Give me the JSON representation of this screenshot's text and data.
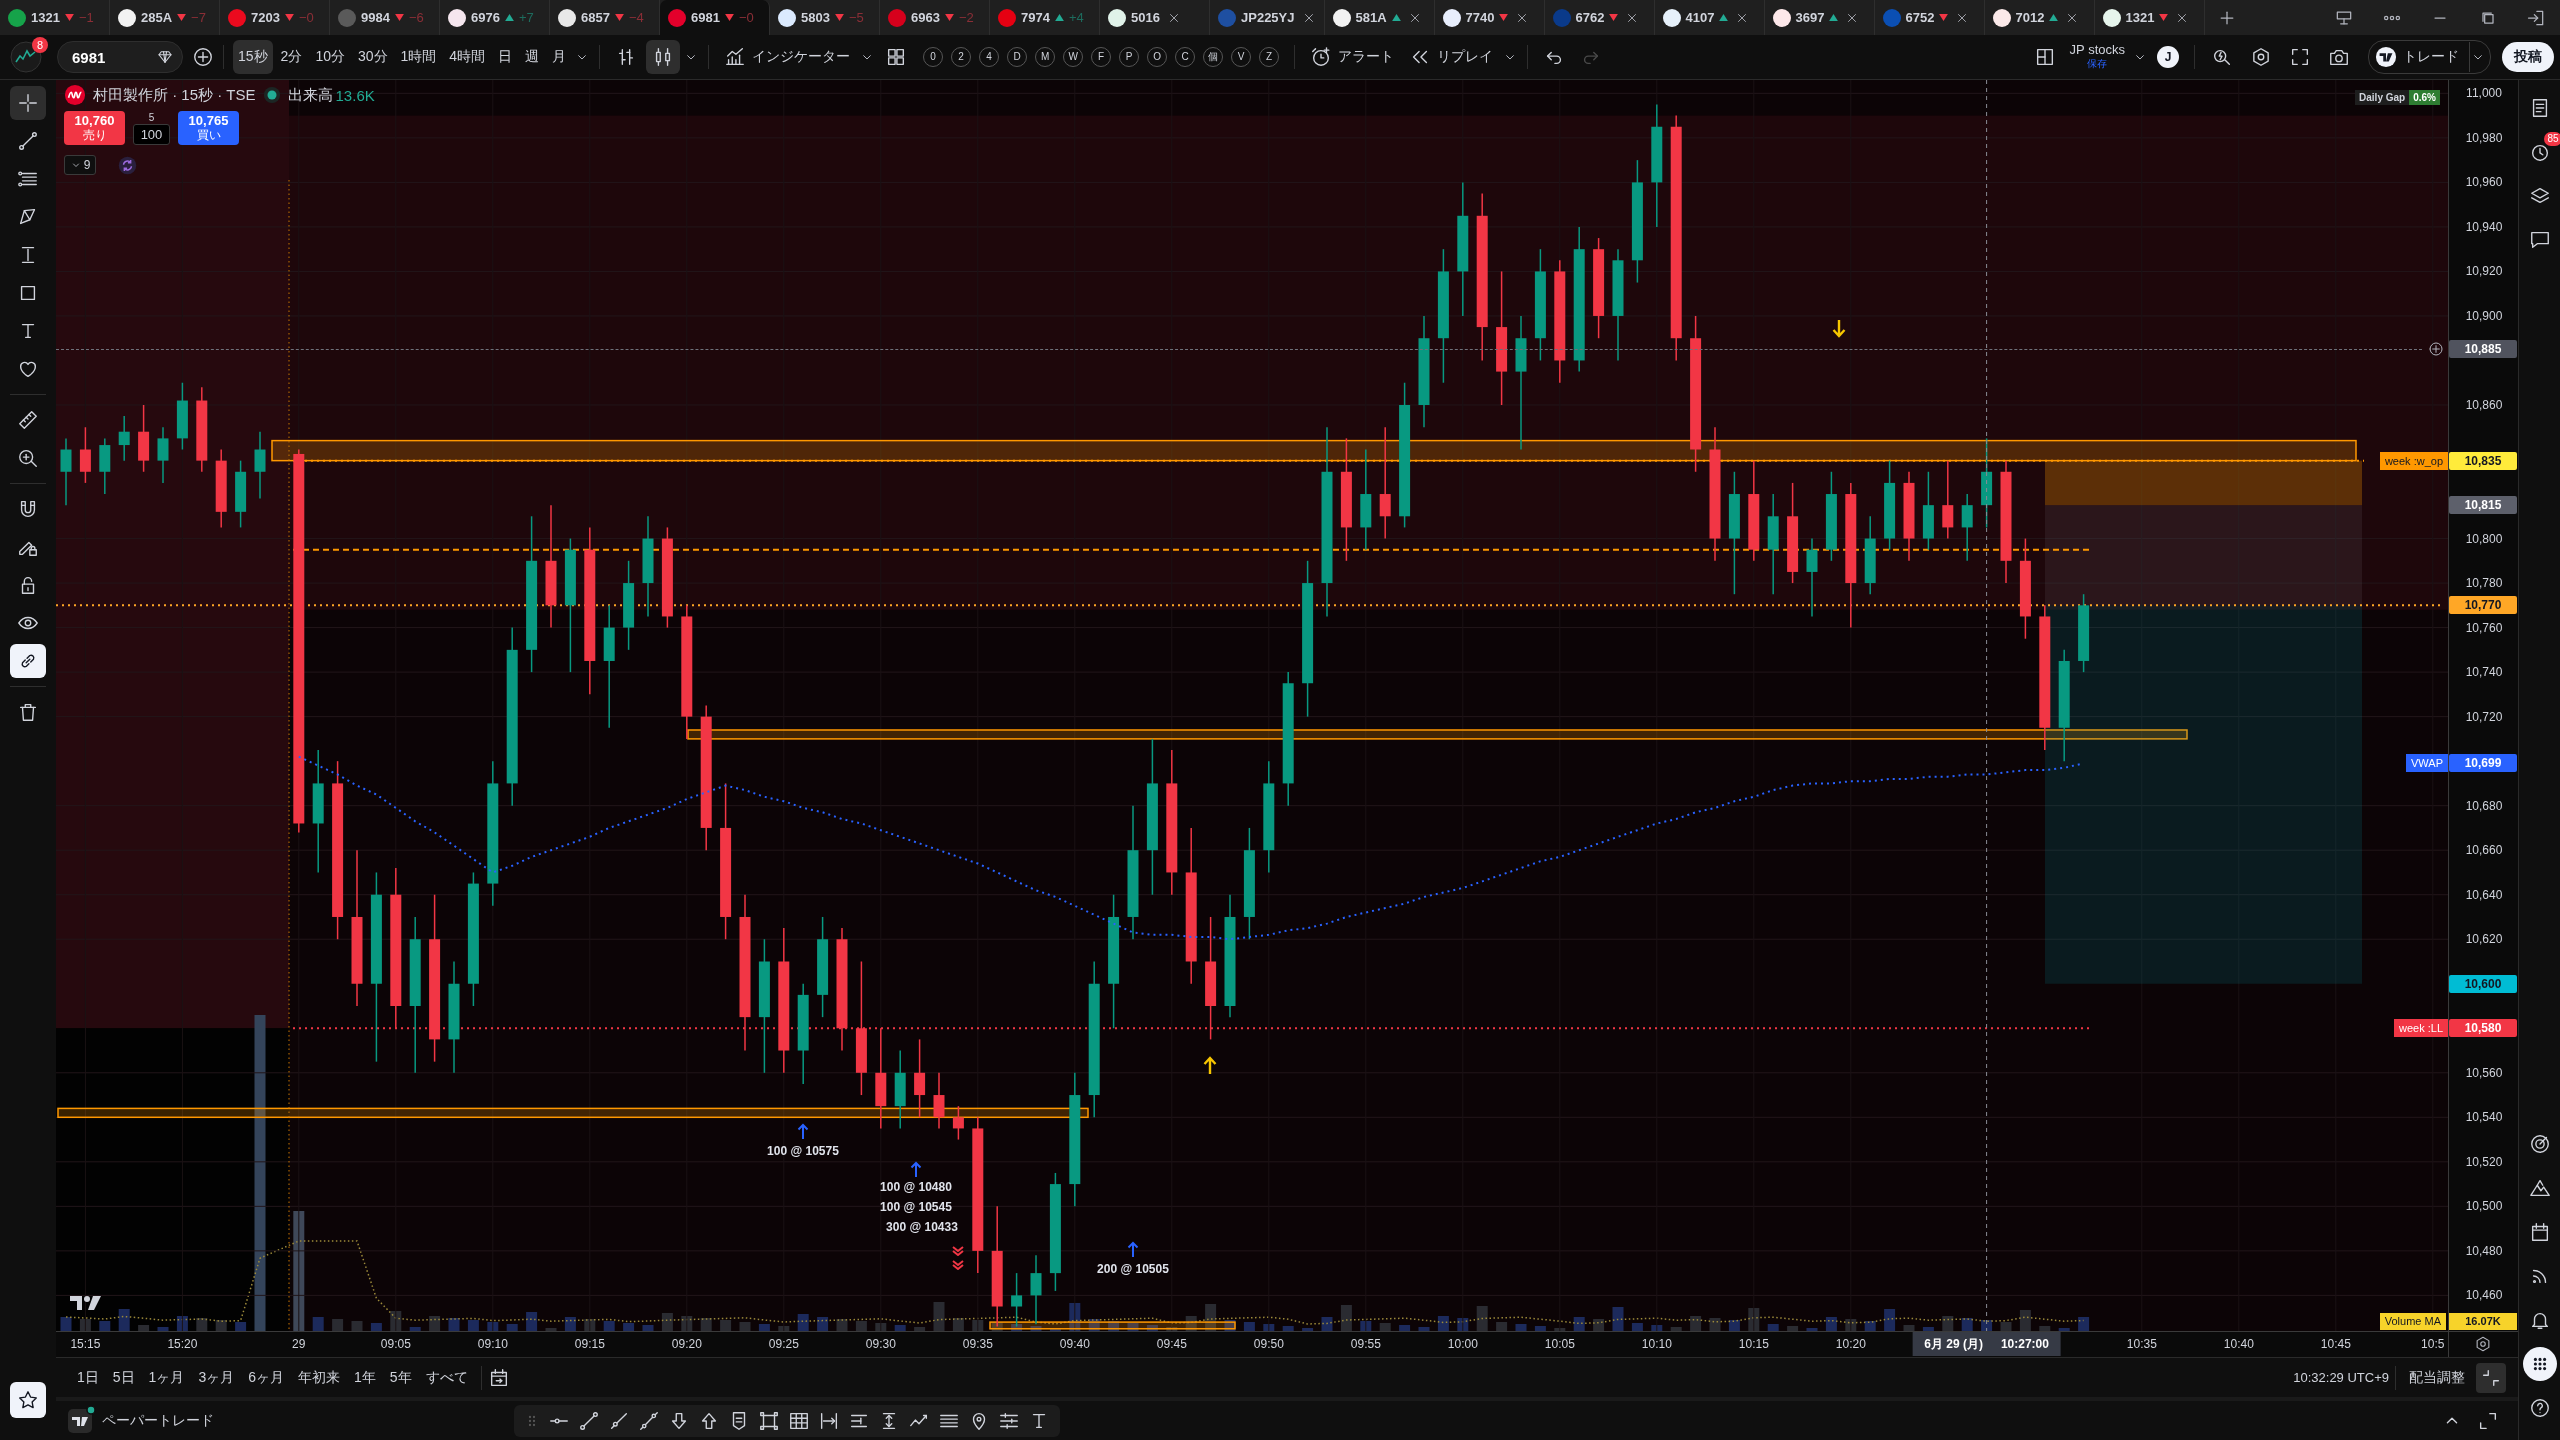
{
  "tabs": [
    {
      "symbol": "1321",
      "rising": false,
      "change": "−1",
      "color": "#16a34a",
      "closable": false,
      "selected": false
    },
    {
      "symbol": "285A",
      "rising": false,
      "change": "−7",
      "color": "#f2f2f2",
      "closable": false,
      "selected": false
    },
    {
      "symbol": "7203",
      "rising": false,
      "change": "−0",
      "color": "#eb0a1e",
      "closable": false,
      "selected": false
    },
    {
      "symbol": "9984",
      "rising": false,
      "change": "−6",
      "color": "#5a5a5a",
      "closable": false,
      "selected": false
    },
    {
      "symbol": "6976",
      "rising": true,
      "change": "+7",
      "color": "#f5e6ee",
      "closable": false,
      "selected": false
    },
    {
      "symbol": "6857",
      "rising": false,
      "change": "−4",
      "color": "#e8e8e8",
      "closable": false,
      "selected": false
    },
    {
      "symbol": "6981",
      "rising": false,
      "change": "−0",
      "color": "#e4002b",
      "closable": false,
      "selected": true
    },
    {
      "symbol": "5803",
      "rising": false,
      "change": "−5",
      "color": "#dbeafe",
      "closable": false,
      "selected": false
    },
    {
      "symbol": "6963",
      "rising": false,
      "change": "−2",
      "color": "#d6001c",
      "closable": false,
      "selected": false
    },
    {
      "symbol": "7974",
      "rising": true,
      "change": "+4",
      "color": "#e60012",
      "closable": false,
      "selected": false
    },
    {
      "symbol": "5016",
      "color": "#e0f2e9",
      "closable": true,
      "selected": false
    },
    {
      "symbol": "JP225YJ",
      "color": "#1e4fa1",
      "closable": true,
      "selected": false
    },
    {
      "symbol": "581A",
      "rising": true,
      "color": "#f2f2f2",
      "closable": true,
      "selected": false
    },
    {
      "symbol": "7740",
      "rising": false,
      "color": "#e8eefc",
      "closable": true,
      "selected": false
    },
    {
      "symbol": "6762",
      "rising": false,
      "color": "#0a3a8a",
      "closable": true,
      "selected": false
    },
    {
      "symbol": "4107",
      "rising": true,
      "color": "#e6f0fa",
      "closable": true,
      "selected": false
    },
    {
      "symbol": "3697",
      "rising": true,
      "color": "#fde8ea",
      "closable": true,
      "selected": false
    },
    {
      "symbol": "6752",
      "rising": false,
      "color": "#0b4fb3",
      "closable": true,
      "selected": false
    },
    {
      "symbol": "7012",
      "rising": true,
      "color": "#fbe9e9",
      "closable": true,
      "selected": false
    },
    {
      "symbol": "1321",
      "rising": false,
      "color": "#e6f5ec",
      "closable": true,
      "selected": false
    }
  ],
  "toolbar": {
    "notifications": "8",
    "symbol": "6981",
    "intervals": [
      {
        "label": "15秒",
        "selected": true
      },
      {
        "label": "2分",
        "selected": false
      },
      {
        "label": "10分",
        "selected": false
      },
      {
        "label": "30分",
        "selected": false
      },
      {
        "label": "1時間",
        "selected": false
      },
      {
        "label": "4時間",
        "selected": false
      },
      {
        "label": "日",
        "selected": false
      },
      {
        "label": "週",
        "selected": false
      },
      {
        "label": "月",
        "selected": false
      }
    ],
    "chart_types": [
      {
        "kind": "bars",
        "selected": false
      },
      {
        "kind": "candles",
        "selected": true
      }
    ],
    "indicators": "インジケーター",
    "quick_keys": [
      "0",
      "2",
      "4",
      "D",
      "M",
      "W",
      "F",
      "P",
      "O",
      "C",
      "個",
      "V",
      "Z"
    ],
    "alert": "アラート",
    "replay": "リプレイ",
    "undo_disabled": false,
    "redo_disabled": true,
    "layout": {
      "name": "JP stocks",
      "status": "保存"
    },
    "user_initial": "J",
    "trade": "トレード",
    "publish": "投稿"
  },
  "left_toolbar": {
    "tool_groups": [
      [
        {
          "kind": "crosshair",
          "selected": true
        },
        {
          "kind": "trend",
          "selected": false
        },
        {
          "kind": "fib",
          "selected": false
        },
        {
          "kind": "pattern",
          "selected": false
        },
        {
          "kind": "projection",
          "selected": false
        },
        {
          "kind": "rectangle",
          "selected": false
        },
        {
          "kind": "text",
          "selected": false
        },
        {
          "kind": "heart",
          "selected": false
        }
      ],
      [
        {
          "kind": "ruler",
          "selected": false
        },
        {
          "kind": "zoom",
          "selected": false
        }
      ]
    ],
    "toggles": [
      {
        "kind": "magnet",
        "on": false
      },
      {
        "kind": "pencillock",
        "on": false
      },
      {
        "kind": "lock",
        "on": false
      },
      {
        "kind": "eye",
        "on": false
      },
      {
        "kind": "link",
        "on": true
      }
    ]
  },
  "chart": {
    "header": {
      "title": "村田製作所 · 15秒 · TSE",
      "market_open": true,
      "volume_label": "出来高",
      "volume": "13.6K"
    },
    "order_panel": {
      "sell_price": "10,760",
      "sell_label": "売り",
      "spread": "5",
      "quantity": "100",
      "buy_price": "10,765",
      "buy_label": "買い"
    },
    "indicator_toggle": {
      "count": "9"
    },
    "daily_gap": {
      "label": "Daily Gap",
      "value": "0.6%"
    },
    "chart_data": [
      {
        "type": "candlestick",
        "categories": [
          null,
          "15:15",
          null,
          null,
          null,
          null,
          "15:20",
          null,
          null,
          null,
          null,
          null,
          "29",
          null,
          null,
          null,
          null,
          "09:05",
          null,
          null,
          null,
          null,
          "09:10",
          null,
          null,
          null,
          null,
          "09:15",
          null,
          null,
          null,
          null,
          "09:20",
          null,
          null,
          null,
          null,
          "09:25",
          null,
          null,
          null,
          null,
          "09:30",
          null,
          null,
          null,
          null,
          "09:35",
          null,
          null,
          null,
          null,
          "09:40",
          null,
          null,
          null,
          null,
          "09:45",
          null,
          null,
          null,
          null,
          "09:50",
          null,
          null,
          null,
          null,
          "09:55",
          null,
          null,
          null,
          null,
          "10:00",
          null,
          null,
          null,
          null,
          "10:05",
          null,
          null,
          null,
          null,
          "10:10",
          null,
          null,
          null,
          null,
          "10:15",
          null,
          null,
          null,
          null,
          "10:20",
          null,
          null,
          null,
          null,
          null,
          null,
          null,
          null,
          null,
          null,
          null,
          null,
          null,
          null,
          "10:35",
          null,
          null,
          null,
          null,
          "10:40",
          null,
          null,
          null,
          null,
          "10:45",
          null,
          null,
          null,
          null,
          "10:5"
        ],
        "ohlc": [
          [
            10830,
            10845,
            10815,
            10840
          ],
          [
            10840,
            10850,
            10825,
            10830
          ],
          [
            10830,
            10845,
            10820,
            10842
          ],
          [
            10842,
            10855,
            10835,
            10848
          ],
          [
            10848,
            10860,
            10830,
            10835
          ],
          [
            10835,
            10850,
            10825,
            10845
          ],
          [
            10845,
            10870,
            10840,
            10862
          ],
          [
            10862,
            10868,
            10830,
            10835
          ],
          [
            10835,
            10840,
            10805,
            10812
          ],
          [
            10812,
            10835,
            10805,
            10830
          ],
          [
            10830,
            10848,
            10818,
            10840
          ],
          null,
          [
            10838,
            10840,
            10668,
            10672
          ],
          [
            10672,
            10705,
            10650,
            10690
          ],
          [
            10690,
            10700,
            10620,
            10630
          ],
          [
            10630,
            10660,
            10590,
            10600
          ],
          [
            10600,
            10650,
            10565,
            10640
          ],
          [
            10640,
            10652,
            10580,
            10590
          ],
          [
            10590,
            10630,
            10560,
            10620
          ],
          [
            10620,
            10640,
            10565,
            10575
          ],
          [
            10575,
            10610,
            10560,
            10600
          ],
          [
            10600,
            10650,
            10590,
            10645
          ],
          [
            10645,
            10700,
            10635,
            10690
          ],
          [
            10690,
            10760,
            10680,
            10750
          ],
          [
            10750,
            10810,
            10740,
            10790
          ],
          [
            10790,
            10815,
            10760,
            10770
          ],
          [
            10770,
            10800,
            10740,
            10795
          ],
          [
            10795,
            10805,
            10730,
            10745
          ],
          [
            10745,
            10770,
            10715,
            10760
          ],
          [
            10760,
            10790,
            10750,
            10780
          ],
          [
            10780,
            10810,
            10765,
            10800
          ],
          [
            10800,
            10805,
            10760,
            10765
          ],
          [
            10765,
            10770,
            10710,
            10720
          ],
          [
            10720,
            10725,
            10660,
            10670
          ],
          [
            10670,
            10690,
            10620,
            10630
          ],
          [
            10630,
            10640,
            10570,
            10585
          ],
          [
            10585,
            10620,
            10560,
            10610
          ],
          [
            10610,
            10625,
            10560,
            10570
          ],
          [
            10570,
            10600,
            10555,
            10595
          ],
          [
            10595,
            10630,
            10585,
            10620
          ],
          [
            10620,
            10625,
            10570,
            10580
          ],
          [
            10580,
            10610,
            10550,
            10560
          ],
          [
            10560,
            10580,
            10535,
            10545
          ],
          [
            10545,
            10570,
            10535,
            10560
          ],
          [
            10560,
            10575,
            10540,
            10550
          ],
          [
            10550,
            10560,
            10535,
            10540
          ],
          [
            10540,
            10545,
            10530,
            10535
          ],
          [
            10535,
            10540,
            10470,
            10480
          ],
          [
            10480,
            10500,
            10446,
            10455
          ],
          [
            10455,
            10470,
            10446,
            10460
          ],
          [
            10460,
            10478,
            10447,
            10470
          ],
          [
            10470,
            10515,
            10462,
            10510
          ],
          [
            10510,
            10560,
            10500,
            10550
          ],
          [
            10550,
            10610,
            10540,
            10600
          ],
          [
            10600,
            10640,
            10580,
            10630
          ],
          [
            10630,
            10680,
            10620,
            10660
          ],
          [
            10660,
            10710,
            10640,
            10690
          ],
          [
            10690,
            10705,
            10640,
            10650
          ],
          [
            10650,
            10670,
            10600,
            10610
          ],
          [
            10610,
            10630,
            10575,
            10590
          ],
          [
            10590,
            10640,
            10585,
            10630
          ],
          [
            10630,
            10670,
            10620,
            10660
          ],
          [
            10660,
            10700,
            10650,
            10690
          ],
          [
            10690,
            10740,
            10680,
            10735
          ],
          [
            10735,
            10790,
            10720,
            10780
          ],
          [
            10780,
            10850,
            10765,
            10830
          ],
          [
            10830,
            10845,
            10790,
            10805
          ],
          [
            10805,
            10840,
            10795,
            10820
          ],
          [
            10820,
            10850,
            10800,
            10810
          ],
          [
            10810,
            10870,
            10805,
            10860
          ],
          [
            10860,
            10900,
            10850,
            10890
          ],
          [
            10890,
            10930,
            10870,
            10920
          ],
          [
            10920,
            10960,
            10900,
            10945
          ],
          [
            10945,
            10955,
            10880,
            10895
          ],
          [
            10895,
            10920,
            10860,
            10875
          ],
          [
            10875,
            10900,
            10840,
            10890
          ],
          [
            10890,
            10930,
            10880,
            10920
          ],
          [
            10920,
            10925,
            10870,
            10880
          ],
          [
            10880,
            10940,
            10875,
            10930
          ],
          [
            10930,
            10935,
            10890,
            10900
          ],
          [
            10900,
            10930,
            10880,
            10925
          ],
          [
            10925,
            10970,
            10915,
            10960
          ],
          [
            10960,
            10995,
            10940,
            10985
          ],
          [
            10985,
            10990,
            10880,
            10890
          ],
          [
            10890,
            10900,
            10830,
            10840
          ],
          [
            10840,
            10850,
            10790,
            10800
          ],
          [
            10800,
            10830,
            10775,
            10820
          ],
          [
            10820,
            10835,
            10790,
            10795
          ],
          [
            10795,
            10820,
            10775,
            10810
          ],
          [
            10810,
            10825,
            10780,
            10785
          ],
          [
            10785,
            10800,
            10765,
            10795
          ],
          [
            10795,
            10830,
            10790,
            10820
          ],
          [
            10820,
            10825,
            10760,
            10780
          ],
          [
            10780,
            10810,
            10775,
            10800
          ],
          [
            10800,
            10835,
            10795,
            10825
          ],
          [
            10825,
            10830,
            10790,
            10800
          ],
          [
            10800,
            10830,
            10795,
            10815
          ],
          [
            10815,
            10835,
            10800,
            10805
          ],
          [
            10805,
            10820,
            10790,
            10815
          ],
          [
            10815,
            10845,
            10805,
            10830
          ],
          [
            10830,
            10835,
            10780,
            10790
          ],
          [
            10790,
            10800,
            10755,
            10765
          ],
          [
            10765,
            10770,
            10705,
            10715
          ],
          [
            10715,
            10750,
            10700,
            10745
          ],
          [
            10745,
            10775,
            10740,
            10770
          ],
          null,
          null,
          null,
          null,
          null,
          null,
          null,
          null,
          null,
          null,
          null,
          null,
          null,
          null,
          null,
          null,
          null,
          null
        ],
        "series": [
          {
            "name": "VWAP",
            "type": "line",
            "color": "#2962ff",
            "line_style": "dotted",
            "values": [
              null,
              null,
              null,
              null,
              null,
              null,
              null,
              null,
              null,
              null,
              null,
              null,
              10702,
              10698,
              10694,
              10689,
              10685,
              10679,
              10673,
              10668,
              10662,
              10656,
              10650,
              10653,
              10657,
              10660,
              10663,
              10666,
              10670,
              10673,
              10676,
              10679,
              10683,
              10686,
              10689,
              10687,
              10684,
              10682,
              10679,
              10677,
              10674,
              10672,
              10669,
              10666,
              10663,
              10660,
              10657,
              10654,
              10650,
              10646,
              10642,
              10639,
              10635,
              10631,
              10627,
              10623,
              10622,
              10622,
              10621,
              10621,
              10620,
              10621,
              10622,
              10624,
              10625,
              10627,
              10630,
              10632,
              10634,
              10636,
              10639,
              10641,
              10643,
              10646,
              10649,
              10652,
              10655,
              10657,
              10660,
              10663,
              10666,
              10669,
              10672,
              10674,
              10677,
              10679,
              10682,
              10684,
              10687,
              10689,
              10690,
              10690,
              10691,
              10691,
              10692,
              10692,
              10693,
              10693,
              10694,
              10694,
              10695,
              10696,
              10696,
              10697,
              10699,
              null,
              null,
              null,
              null,
              null,
              null,
              null,
              null,
              null,
              null,
              null,
              null,
              null,
              null,
              null,
              null,
              null,
              null
            ]
          }
        ],
        "ylim": [
          10444,
          11006
        ],
        "yticks": [
          {
            "value": 10460,
            "label": "10,460"
          },
          {
            "value": 10480,
            "label": "10,480"
          },
          {
            "value": 10500,
            "label": "10,500"
          },
          {
            "value": 10520,
            "label": "10,520"
          },
          {
            "value": 10540,
            "label": "10,540"
          },
          {
            "value": 10560,
            "label": "10,560"
          },
          {
            "value": 10620,
            "label": "10,620"
          },
          {
            "value": 10640,
            "label": "10,640"
          },
          {
            "value": 10660,
            "label": "10,660"
          },
          {
            "value": 10680,
            "label": "10,680"
          },
          {
            "value": 10720,
            "label": "10,720"
          },
          {
            "value": 10740,
            "label": "10,740"
          },
          {
            "value": 10760,
            "label": "10,760"
          },
          {
            "value": 10780,
            "label": "10,780"
          },
          {
            "value": 10800,
            "label": "10,800"
          },
          {
            "value": 10860,
            "label": "10,860"
          },
          {
            "value": 10900,
            "label": "10,900"
          },
          {
            "value": 10920,
            "label": "10,920"
          },
          {
            "value": 10940,
            "label": "10,940"
          },
          {
            "value": 10960,
            "label": "10,960"
          },
          {
            "value": 10980,
            "label": "10,980"
          },
          {
            "value": 11000,
            "label": "11,000"
          }
        ],
        "ref_lines": [
          {
            "axis": "y",
            "value": 10835,
            "label": "week :w_op",
            "color": "#ff9800",
            "line_style": "dotted"
          },
          {
            "axis": "y",
            "value": 10795,
            "color": "#ff9800",
            "line_style": "dashed"
          },
          {
            "axis": "y",
            "value": 10770,
            "color": "#ffa726",
            "line_style": "dotted"
          },
          {
            "axis": "y",
            "value": 10580,
            "label": "week :LL",
            "color": "#f23645",
            "line_style": "dotted"
          }
        ],
        "grid": true
      }
    ],
    "price_tags": [
      {
        "kind": "crosshair",
        "text": "10,885"
      },
      {
        "kind": "level",
        "text": "10,835",
        "color": "#ffeb3b"
      },
      {
        "kind": "level",
        "text": "10,815",
        "color": "#5d606b"
      },
      {
        "kind": "level",
        "text": "10,770",
        "color": "#ffa726"
      },
      {
        "kind": "level",
        "text": "10,699",
        "color": "#2962ff"
      },
      {
        "kind": "level",
        "text": "10,600",
        "color": "#00bcd4"
      },
      {
        "kind": "level",
        "text": "10,580",
        "color": "#f23645"
      }
    ],
    "crosshair": {
      "date": "6月 29 (月)",
      "time": "10:27:00"
    },
    "executions": [
      {
        "text": "100 @ 10575",
        "kind": "buy"
      },
      {
        "text": "100 @ 10480",
        "kind": "buy"
      },
      {
        "text": "100 @ 10545",
        "kind": "sell"
      },
      {
        "text": "300 @ 10433",
        "kind": "sell"
      },
      {
        "text": "200 @ 10505",
        "kind": "buy"
      }
    ],
    "volume": {
      "ma_label": "Volume MA",
      "ma_value": "16.07K"
    }
  },
  "right_sidebar": {
    "top": [
      {
        "kind": "watchlist",
        "selected": false
      },
      {
        "kind": "alerts",
        "badge": "85",
        "selected": false
      },
      {
        "kind": "layers",
        "selected": false
      },
      {
        "kind": "chat",
        "selected": false
      }
    ],
    "bottom": [
      {
        "kind": "target",
        "selected": false
      },
      {
        "kind": "mountains",
        "selected": false
      },
      {
        "kind": "calendar",
        "selected": false
      },
      {
        "kind": "rss",
        "selected": false
      },
      {
        "kind": "bell",
        "selected": false
      },
      {
        "kind": "apps",
        "selected": true
      },
      {
        "kind": "help",
        "selected": false
      }
    ]
  },
  "bottom_bar": {
    "ranges": [
      "1日",
      "5日",
      "1ヶ月",
      "3ヶ月",
      "6ヶ月",
      "年初来",
      "1年",
      "5年",
      "すべて"
    ],
    "clock": "10:32:29 UTC+9",
    "adjustment": "配当調整"
  },
  "trading_panel": {
    "title": "ペーパートレード",
    "connected": true
  }
}
